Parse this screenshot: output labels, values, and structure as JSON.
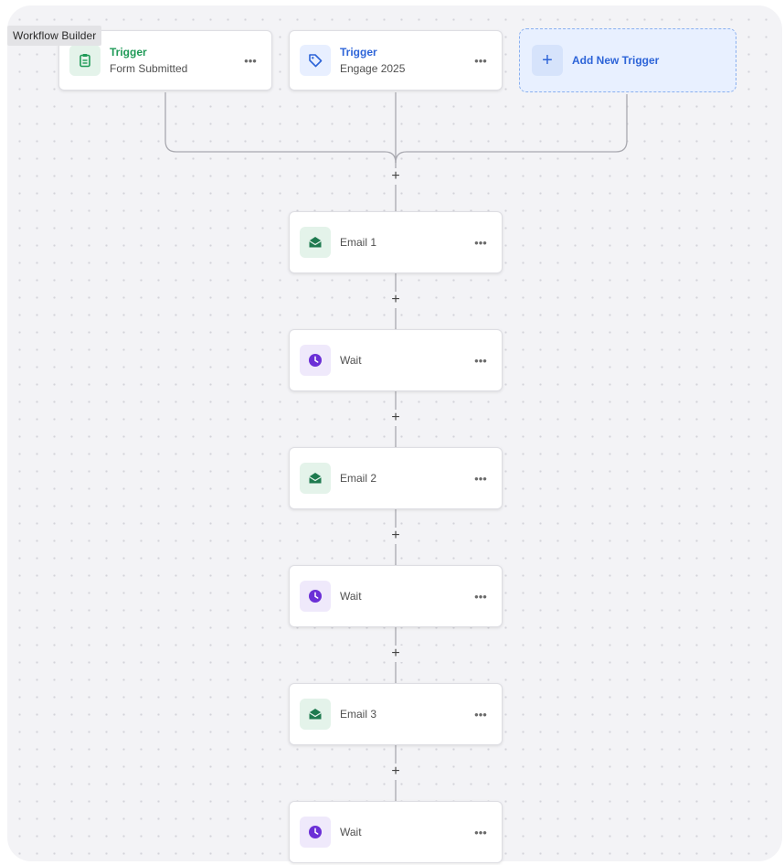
{
  "app": {
    "title": "Workflow Builder"
  },
  "colors": {
    "trigger_green": "#1f9a57",
    "trigger_blue": "#2d64d8",
    "email_green": "#1e7a4f",
    "wait_purple": "#6b2fd6",
    "add_blue": "#2d64d8"
  },
  "triggers": [
    {
      "kind": "Trigger",
      "description": "Form Submitted",
      "icon": "clipboard-icon",
      "more": "•••"
    },
    {
      "kind": "Trigger",
      "description": "Engage 2025",
      "icon": "tag-icon",
      "more": "•••"
    }
  ],
  "add_trigger": {
    "plus": "+",
    "label": "Add New Trigger"
  },
  "steps": [
    {
      "label": "Email 1",
      "icon": "envelope-icon",
      "more": "•••"
    },
    {
      "label": "Wait",
      "icon": "clock-icon",
      "more": "•••"
    },
    {
      "label": "Email 2",
      "icon": "envelope-icon",
      "more": "•••"
    },
    {
      "label": "Wait",
      "icon": "clock-icon",
      "more": "•••"
    },
    {
      "label": "Email 3",
      "icon": "envelope-icon",
      "more": "•••"
    },
    {
      "label": "Wait",
      "icon": "clock-icon",
      "more": "•••"
    }
  ],
  "add_step_symbol": "+"
}
